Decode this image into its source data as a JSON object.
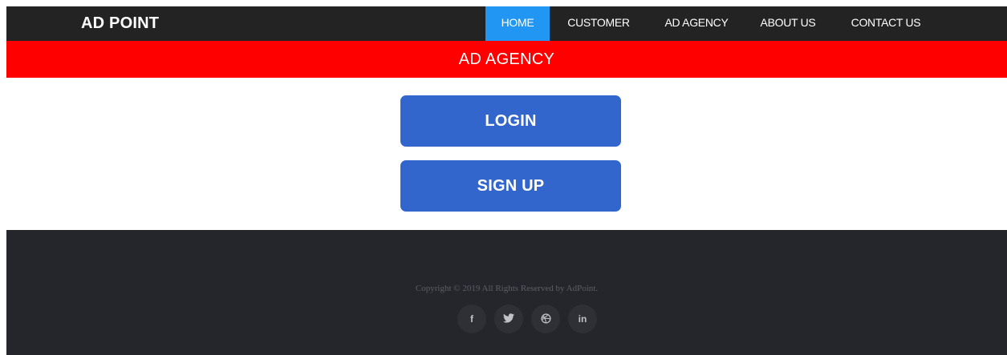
{
  "header": {
    "brand": "AD POINT",
    "nav": {
      "home": "HOME",
      "customer": "CUSTOMER",
      "ad_agency": "AD AGENCY",
      "about_us": "ABOUT US",
      "contact_us": "CONTACT US"
    },
    "active_item": "HOME"
  },
  "banner": {
    "title": "AD AGENCY"
  },
  "main": {
    "login_label": "LOGIN",
    "signup_label": "SIGN UP"
  },
  "footer": {
    "copyright": "Copyright © 2019 All Rights Reserved by AdPoint.",
    "social": [
      {
        "icon": "facebook-icon",
        "glyph": "f"
      },
      {
        "icon": "twitter-icon",
        "glyph": ""
      },
      {
        "icon": "dribbble-icon",
        "glyph": ""
      },
      {
        "icon": "linkedin-icon",
        "glyph": "in"
      }
    ]
  },
  "colors": {
    "nav_bg": "#232323",
    "nav_active": "#2196f3",
    "banner_bg": "#ff0000",
    "button_bg": "#3366cc",
    "footer_bg": "#25262b"
  }
}
